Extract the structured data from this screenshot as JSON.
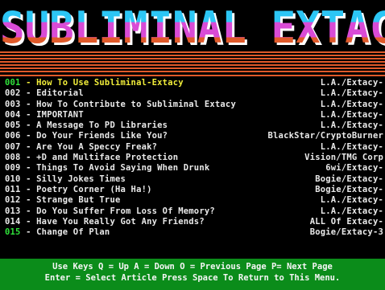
{
  "logo": {
    "text": "SUBLIMINAL EXTACY",
    "colors": {
      "top": "#2cc6f5",
      "mid": "#d94bd6",
      "bottom": "#e05a2a",
      "shadow": "#ffffff"
    }
  },
  "menu": {
    "items": [
      {
        "num": "001",
        "sep": " - ",
        "title": "How To Use Subliminal-Extacy",
        "author": "L.A./Extacy-"
      },
      {
        "num": "002",
        "sep": " - ",
        "title": "Editorial",
        "author": "L.A./Extacy-"
      },
      {
        "num": "003",
        "sep": " - ",
        "title": "How To Contribute to Subliminal Extacy",
        "author": "L.A./Extacy-"
      },
      {
        "num": "004",
        "sep": " - ",
        "title": "IMPORTANT",
        "author": "L.A./Extacy-"
      },
      {
        "num": "005",
        "sep": " - ",
        "title": "A Message To PD Libraries",
        "author": "L.A./Extacy-"
      },
      {
        "num": "006",
        "sep": " - ",
        "title": "Do Your Friends Like You?",
        "author": "BlackStar/CryptoBurner"
      },
      {
        "num": "007",
        "sep": " - ",
        "title": "Are You A Speccy Freak?",
        "author": "L.A./Extacy-"
      },
      {
        "num": "008",
        "sep": " - ",
        "title": "+D and Multiface Protection",
        "author": "Vision/TMG Corp"
      },
      {
        "num": "009",
        "sep": " - ",
        "title": "Things To Avoid Saying When Drunk",
        "author": "6wi/Extacy-"
      },
      {
        "num": "010",
        "sep": " - ",
        "title": "Silly Jokes Times",
        "author": "Bogie/Extacy-"
      },
      {
        "num": "011",
        "sep": " - ",
        "title": "Poetry Corner (Ha Ha!)",
        "author": "Bogie/Extacy-"
      },
      {
        "num": "012",
        "sep": " - ",
        "title": "Strange But True",
        "author": "L.A./Extacy-"
      },
      {
        "num": "013",
        "sep": " - ",
        "title": "Do You Suffer From Loss Of Memory?",
        "author": "L.A./Extacy-"
      },
      {
        "num": "014",
        "sep": " - ",
        "title": "Have You Really Got Any Friends?",
        "author": "ALL Of Extacy-"
      },
      {
        "num": "015",
        "sep": " - ",
        "title": "Change Of Plan",
        "author": "Bogie/Extacy-3"
      }
    ]
  },
  "help": {
    "line1": "Use Keys Q = Up  A = Down  O = Previous Page  P= Next Page",
    "line2": "Enter = Select Article  Press Space To Return to This Menu."
  }
}
